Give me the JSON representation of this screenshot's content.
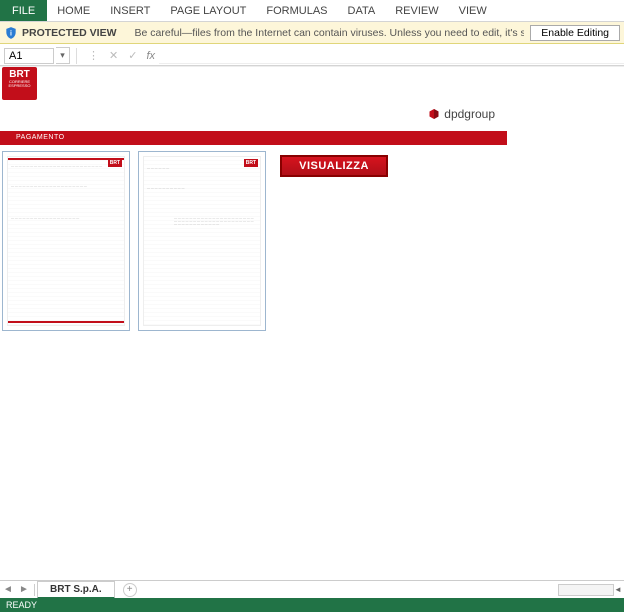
{
  "ribbon": {
    "file": "FILE",
    "tabs": [
      "HOME",
      "INSERT",
      "PAGE LAYOUT",
      "FORMULAS",
      "DATA",
      "REVIEW",
      "VIEW"
    ]
  },
  "protected_view": {
    "title": "PROTECTED VIEW",
    "message": "Be careful—files from the Internet can contain viruses. Unless you need to edit, it's safer to stay in Protected View.",
    "button": "Enable Editing"
  },
  "formula_bar": {
    "name_box": "A1",
    "fx_label": "fx",
    "value": ""
  },
  "banner": {
    "brand": "BRT",
    "brand_sub": "CORRIERE ESPRESSO",
    "partner": "dpdgroup",
    "stripe_label": "PAGAMENTO"
  },
  "thumbnails": [
    {
      "label": "doc-page-1",
      "logo": "BRT"
    },
    {
      "label": "doc-page-2",
      "logo": "BRT"
    }
  ],
  "action_button": "VISUALIZZA",
  "sheet": {
    "active": "BRT S.p.A.",
    "add_tooltip": "+"
  },
  "status": "READY"
}
